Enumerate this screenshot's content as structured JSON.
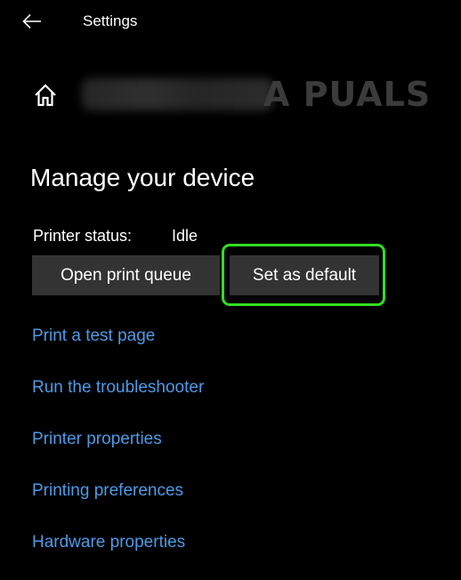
{
  "window": {
    "title": "Settings"
  },
  "header": {
    "watermark_text": "A PUALS"
  },
  "main": {
    "section_title": "Manage your device",
    "status_label": "Printer status:",
    "status_value": "Idle",
    "buttons": {
      "open_queue": "Open print queue",
      "set_default": "Set as default"
    },
    "links": [
      "Print a test page",
      "Run the troubleshooter",
      "Printer properties",
      "Printing preferences",
      "Hardware properties"
    ]
  },
  "icons": {
    "back": "back-arrow-icon",
    "home": "home-icon"
  },
  "colors": {
    "background": "#000000",
    "link": "#4e9ae6",
    "button": "#333333",
    "highlight": "#33dd22"
  }
}
